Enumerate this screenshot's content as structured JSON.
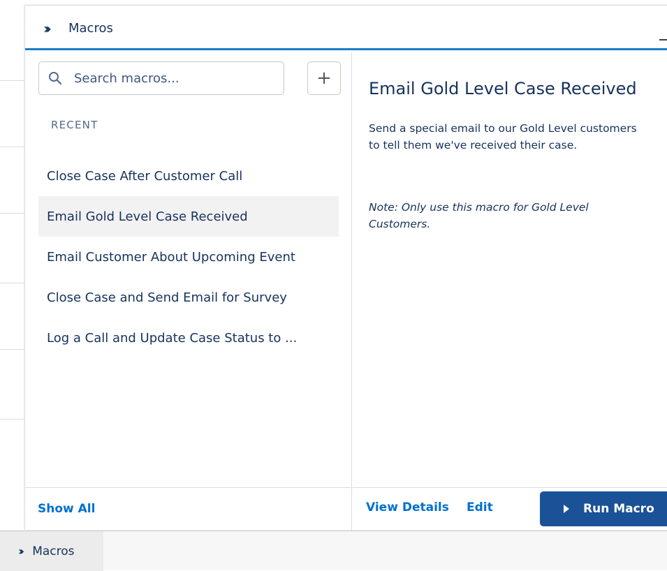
{
  "header": {
    "icon": "macros-chevrons-icon",
    "title": "Macros"
  },
  "search": {
    "placeholder": "Search macros...",
    "value": ""
  },
  "add_button": {
    "label": "+"
  },
  "recent": {
    "label": "RECENT",
    "items": [
      {
        "label": "Close Case After Customer Call",
        "selected": false
      },
      {
        "label": "Email Gold Level Case Received",
        "selected": true
      },
      {
        "label": "Email Customer About Upcoming Event",
        "selected": false
      },
      {
        "label": "Close Case and Send Email for Survey",
        "selected": false
      },
      {
        "label": "Log a Call and Update Case Status to ...",
        "selected": false
      }
    ]
  },
  "footer_left": {
    "show_all": "Show All"
  },
  "detail": {
    "title": "Email Gold Level Case Received",
    "description": "Send a special email to our Gold Level customers to tell them we've received their case.",
    "note": "Note: Only use this macro for Gold Level Customers."
  },
  "footer_right": {
    "view_details": "View Details",
    "edit": "Edit",
    "run_macro": "Run Macro"
  },
  "dock": {
    "label": "Macros"
  },
  "colors": {
    "accent": "#1b7dc6",
    "link": "#0070d2",
    "primary_button": "#1b5297",
    "text": "#16325c",
    "selected_row": "#f3f2f2"
  }
}
